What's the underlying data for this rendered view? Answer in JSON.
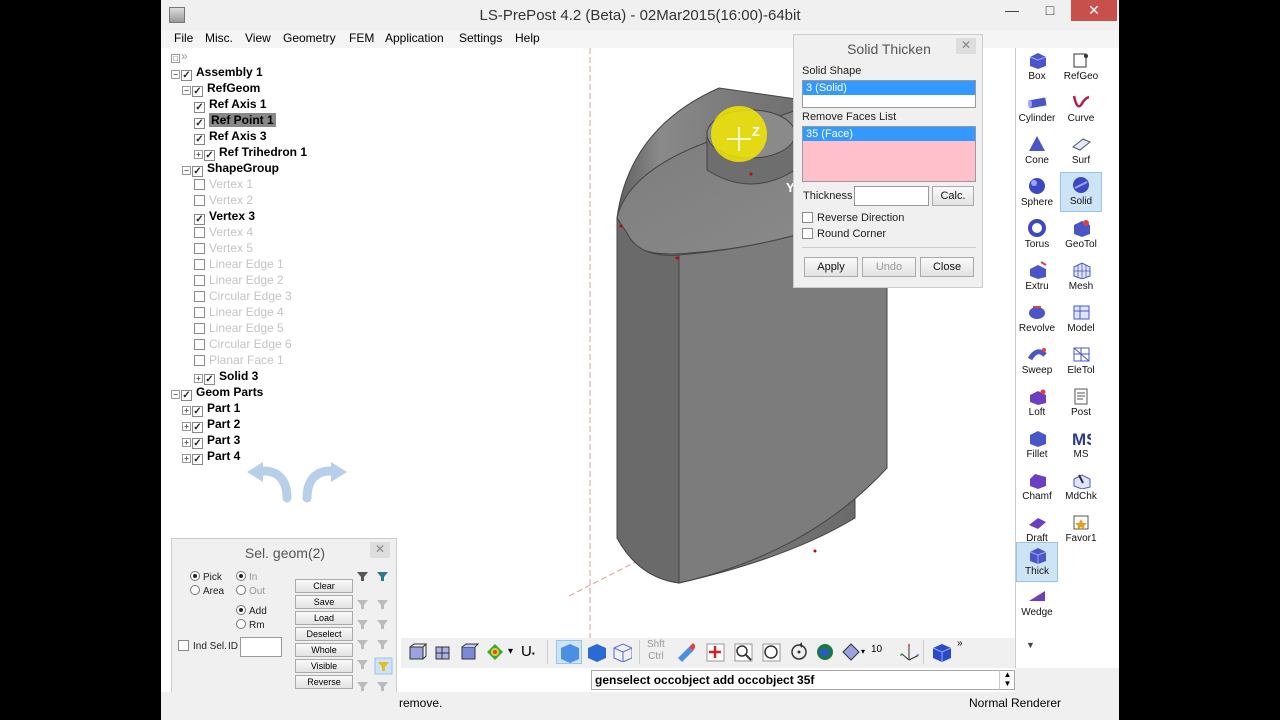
{
  "window": {
    "title": "LS-PrePost 4.2 (Beta) - 02Mar2015(16:00)-64bit",
    "minimize": "—",
    "maximize": "□",
    "close": "✕"
  },
  "menu": [
    "File",
    "Misc.",
    "View",
    "Geometry",
    "FEM",
    "Application",
    "Settings",
    "Help"
  ],
  "tree": {
    "collapse_glyph": "»",
    "items": [
      {
        "label": "Assembly 1",
        "checked": true
      },
      {
        "label": "RefGeom",
        "checked": true
      },
      {
        "label": "Ref Axis 1",
        "checked": true
      },
      {
        "label": "Ref Point 1",
        "checked": true
      },
      {
        "label": "Ref Axis 3",
        "checked": true
      },
      {
        "label": "Ref Trihedron 1",
        "checked": true
      },
      {
        "label": "ShapeGroup",
        "checked": true
      },
      {
        "label": "Vertex 1",
        "checked": false
      },
      {
        "label": "Vertex 2",
        "checked": false
      },
      {
        "label": "Vertex 3",
        "checked": true
      },
      {
        "label": "Vertex 4",
        "checked": false
      },
      {
        "label": "Vertex 5",
        "checked": false
      },
      {
        "label": "Linear Edge 1",
        "checked": false
      },
      {
        "label": "Linear Edge 2",
        "checked": false
      },
      {
        "label": "Circular Edge 3",
        "checked": false
      },
      {
        "label": "Linear Edge 4",
        "checked": false
      },
      {
        "label": "Linear Edge 5",
        "checked": false
      },
      {
        "label": "Circular Edge 6",
        "checked": false
      },
      {
        "label": "Planar Face 1",
        "checked": false
      },
      {
        "label": "Solid 3",
        "checked": true
      },
      {
        "label": "Geom Parts",
        "checked": true
      },
      {
        "label": "Part 1",
        "checked": true
      },
      {
        "label": "Part 2",
        "checked": true
      },
      {
        "label": "Part 3",
        "checked": true
      },
      {
        "label": "Part 4",
        "checked": true
      }
    ]
  },
  "viewport": {
    "axis_z": "Z",
    "axis_y": "Y"
  },
  "solid_thicken": {
    "title": "Solid Thicken",
    "close_glyph": "✕",
    "solid_shape_label": "Solid Shape",
    "solid_shape_value": "3 (Solid)",
    "remove_faces_label": "Remove Faces List",
    "remove_faces_value": "35 (Face)",
    "thickness_label": "Thickness",
    "thickness_value": "",
    "calc_label": "Calc.",
    "reverse_direction_label": "Reverse Direction",
    "round_corner_label": "Round Corner",
    "apply_label": "Apply",
    "undo_label": "Undo",
    "close_label": "Close"
  },
  "toolbox": [
    {
      "label": "Box"
    },
    {
      "label": "RefGeo"
    },
    {
      "label": "Cylinder"
    },
    {
      "label": "Curve"
    },
    {
      "label": "Cone"
    },
    {
      "label": "Surf"
    },
    {
      "label": "Sphere"
    },
    {
      "label": "Solid"
    },
    {
      "label": "Torus"
    },
    {
      "label": "GeoTol"
    },
    {
      "label": "Extru"
    },
    {
      "label": "Mesh"
    },
    {
      "label": "Revolve"
    },
    {
      "label": "Model"
    },
    {
      "label": "Sweep"
    },
    {
      "label": "EleTol"
    },
    {
      "label": "Loft"
    },
    {
      "label": "Post"
    },
    {
      "label": "Fillet"
    },
    {
      "label": "MS"
    },
    {
      "label": "Chamf"
    },
    {
      "label": "MdChk"
    },
    {
      "label": "Draft"
    },
    {
      "label": "Favor1"
    },
    {
      "label": "Thick"
    },
    {
      "label": "Wedge"
    }
  ],
  "sel_geom": {
    "title": "Sel. geom(2)",
    "close_glyph": "✕",
    "pick_label": "Pick",
    "area_label": "Area",
    "in_label": "In",
    "out_label": "Out",
    "add_label": "Add",
    "rm_label": "Rm",
    "ind_sel_label": "Ind Sel.",
    "id_label": "ID",
    "id_value": "",
    "buttons": [
      "Clear",
      "Save",
      "Load",
      "Deselect",
      "Whole",
      "Visible",
      "Reverse"
    ]
  },
  "bottom_toolbar": {
    "shft_label": "Shft",
    "ctrl_label": "Ctrl",
    "u_label": "U",
    "count_label": "10",
    "overflow": "»"
  },
  "command_line": "genselect occobject add occobject  35f",
  "status": {
    "message": "remove.",
    "renderer": "Normal Renderer"
  },
  "colors": {
    "accent": "#3399ff",
    "remove_faces_bg": "#ffc0cb",
    "model_gray": "#7a7a7a"
  }
}
